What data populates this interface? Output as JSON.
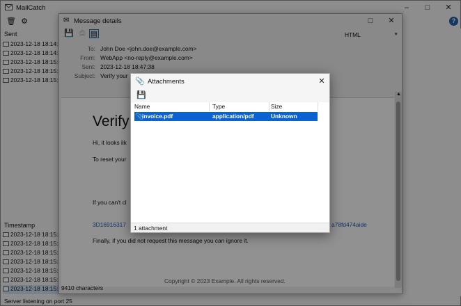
{
  "main": {
    "title": "MailCatch",
    "sent_label": "Sent",
    "sent_rows": [
      "2023-12-18 18:14:2",
      "2023-12-18 18:14:4",
      "2023-12-18 18:15:0",
      "2023-12-18 18:15:1",
      "2023-12-18 18:15:5"
    ],
    "timestamp_label": "Timestamp",
    "received_rows": [
      "2023-12-18 18:15:2",
      "2023-12-18 18:15:2",
      "2023-12-18 18:15:2",
      "2023-12-18 18:15:5",
      "2023-12-18 18:15:5",
      "2023-12-18 18:15:5",
      "2023-12-18 18:15:5"
    ],
    "status": "Server listening on port 25"
  },
  "message": {
    "title": "Message details",
    "format": "HTML",
    "to_label": "To:",
    "to": "John Doe <john.doe@example.com>",
    "from_label": "From:",
    "from": "WebApp <no-reply@example.com>",
    "sent_label": "Sent:",
    "sent": "2023-12-18 18:47:38",
    "subject_label": "Subject:",
    "subject": "Verify your",
    "body_heading": "Verify",
    "body_line1": "Hi, it looks lik",
    "body_line2": "To reset your",
    "body_line3": "If you can't cl",
    "body_link_left": "3D16916317",
    "body_link_right": "a78fd474aide",
    "body_line4": "Finally, if you did not request this message you can ignore it.",
    "footer": "Copyright © 2023 Example. All rights reserved.",
    "char_count": "9410 characters"
  },
  "attachments": {
    "title": "Attachments",
    "columns": {
      "name": "Name",
      "type": "Type",
      "size": "Size"
    },
    "rows": [
      {
        "name": "invoice.pdf",
        "type": "application/pdf",
        "size": "Unknown"
      }
    ],
    "status": "1 attachment"
  }
}
